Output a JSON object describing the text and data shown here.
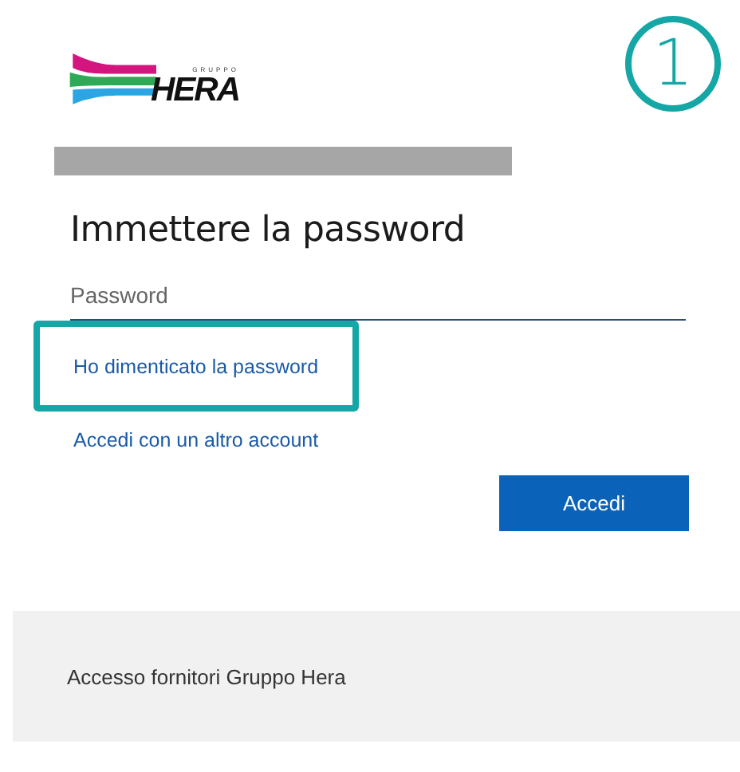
{
  "logo": {
    "tagline": "GRUPPO",
    "name": "HERA"
  },
  "step_badge": "1",
  "heading": "Immettere la password",
  "password_field": {
    "placeholder": "Password"
  },
  "links": [
    {
      "text": "Ho dimenticato la password",
      "highlighted": true
    },
    {
      "text": "Accedi con un altro account",
      "highlighted": false
    }
  ],
  "button": "Accedi",
  "footer": "Accesso fornitori Gruppo Hera"
}
